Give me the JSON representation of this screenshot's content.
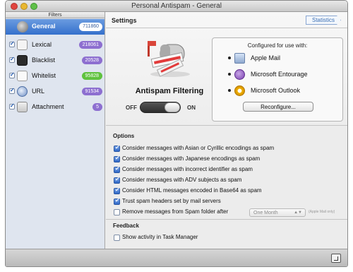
{
  "window": {
    "title": "Personal Antispam - General"
  },
  "sidebar": {
    "header": "Filters",
    "general": {
      "label": "General",
      "count": "711860"
    },
    "items": [
      {
        "label": "Lexical",
        "count": "218061",
        "badge_color": "#8d6fd0"
      },
      {
        "label": "Blacklist",
        "count": "20528",
        "badge_color": "#8d6fd0"
      },
      {
        "label": "Whitelist",
        "count": "95828",
        "badge_color": "#5fc23e"
      },
      {
        "label": "URL",
        "count": "91534",
        "badge_color": "#8d6fd0"
      },
      {
        "label": "Attachment",
        "count": "5",
        "badge_color": "#8d6fd0"
      }
    ]
  },
  "settings": {
    "title": "Settings",
    "statistics_button": "Statistics",
    "antispam_title": "Antispam Filtering",
    "toggle_off": "OFF",
    "toggle_on": "ON",
    "configured_title": "Configured for use with:",
    "apps": [
      {
        "name": "Apple Mail",
        "icon": "apple-mail-icon"
      },
      {
        "name": "Microsoft Entourage",
        "icon": "entourage-icon"
      },
      {
        "name": "Microsoft Outlook",
        "icon": "outlook-icon"
      }
    ],
    "reconfigure_button": "Reconfigure..."
  },
  "options": {
    "title": "Options",
    "items": [
      {
        "label": "Consider messages with Asian or Cyrillic encodings as spam",
        "checked": true
      },
      {
        "label": "Consider messages with Japanese encodings as spam",
        "checked": true
      },
      {
        "label": "Consider messages with incorrect identifier as spam",
        "checked": true
      },
      {
        "label": "Consider messages with ADV subjects as spam",
        "checked": true
      },
      {
        "label": "Consider HTML messages encoded in Base64 as spam",
        "checked": true
      },
      {
        "label": "Trust spam headers set by mail servers",
        "checked": true
      },
      {
        "label": "Remove messages from Spam folder after",
        "checked": false
      }
    ],
    "remove_after_value": "One Month",
    "remove_after_note": "(Apple Mail only)"
  },
  "feedback": {
    "title": "Feedback",
    "show_activity": {
      "label": "Show activity in Task Manager",
      "checked": false
    }
  },
  "colors": {
    "selection_blue": "#3470cc",
    "badge_purple": "#8d6fd0",
    "badge_green": "#5fc23e",
    "sidebar_bg": "#dfe5ef"
  }
}
